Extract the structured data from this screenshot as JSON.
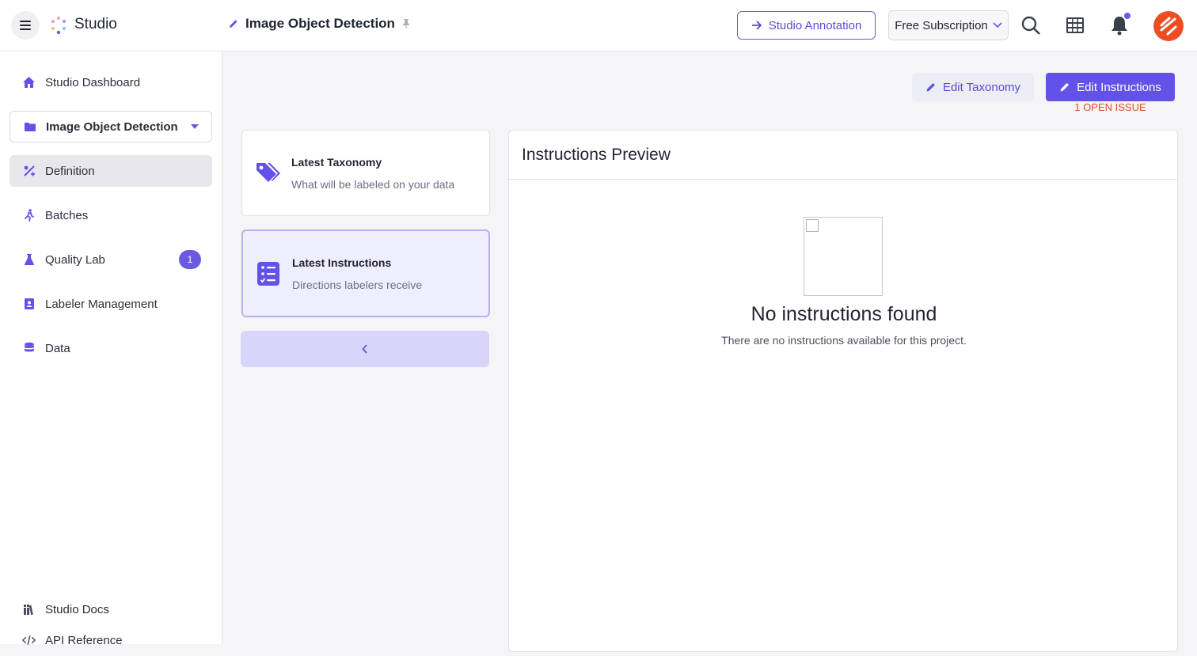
{
  "topbar": {
    "app_title": "Studio",
    "project_title": "Image Object Detection",
    "annotation_button": "Studio Annotation",
    "subscription": "Free Subscription"
  },
  "sidebar": {
    "items": [
      {
        "label": "Studio Dashboard",
        "icon": "home-icon"
      },
      {
        "label": "Image Object Detection",
        "icon": "folder-icon"
      },
      {
        "label": "Definition",
        "icon": "definition-icon"
      },
      {
        "label": "Batches",
        "icon": "runner-icon"
      },
      {
        "label": "Quality Lab",
        "icon": "flask-icon",
        "badge": "1"
      },
      {
        "label": "Labeler Management",
        "icon": "id-card-icon"
      },
      {
        "label": "Data",
        "icon": "database-icon"
      }
    ],
    "footer": [
      {
        "label": "Studio Docs",
        "icon": "books-icon"
      },
      {
        "label": "API Reference",
        "icon": "code-icon"
      }
    ]
  },
  "actions": {
    "edit_taxonomy": "Edit Taxonomy",
    "edit_instructions": "Edit Instructions",
    "open_issue": "1 OPEN ISSUE"
  },
  "cards": [
    {
      "title": "Latest Taxonomy",
      "subtitle": "What will be labeled on your data"
    },
    {
      "title": "Latest Instructions",
      "subtitle": "Directions labelers receive"
    }
  ],
  "preview": {
    "title": "Instructions Preview",
    "empty_title": "No instructions found",
    "empty_subtitle": "There are no instructions available for this project."
  },
  "colors": {
    "accent": "#6352e8",
    "issue": "#e34a2a"
  }
}
